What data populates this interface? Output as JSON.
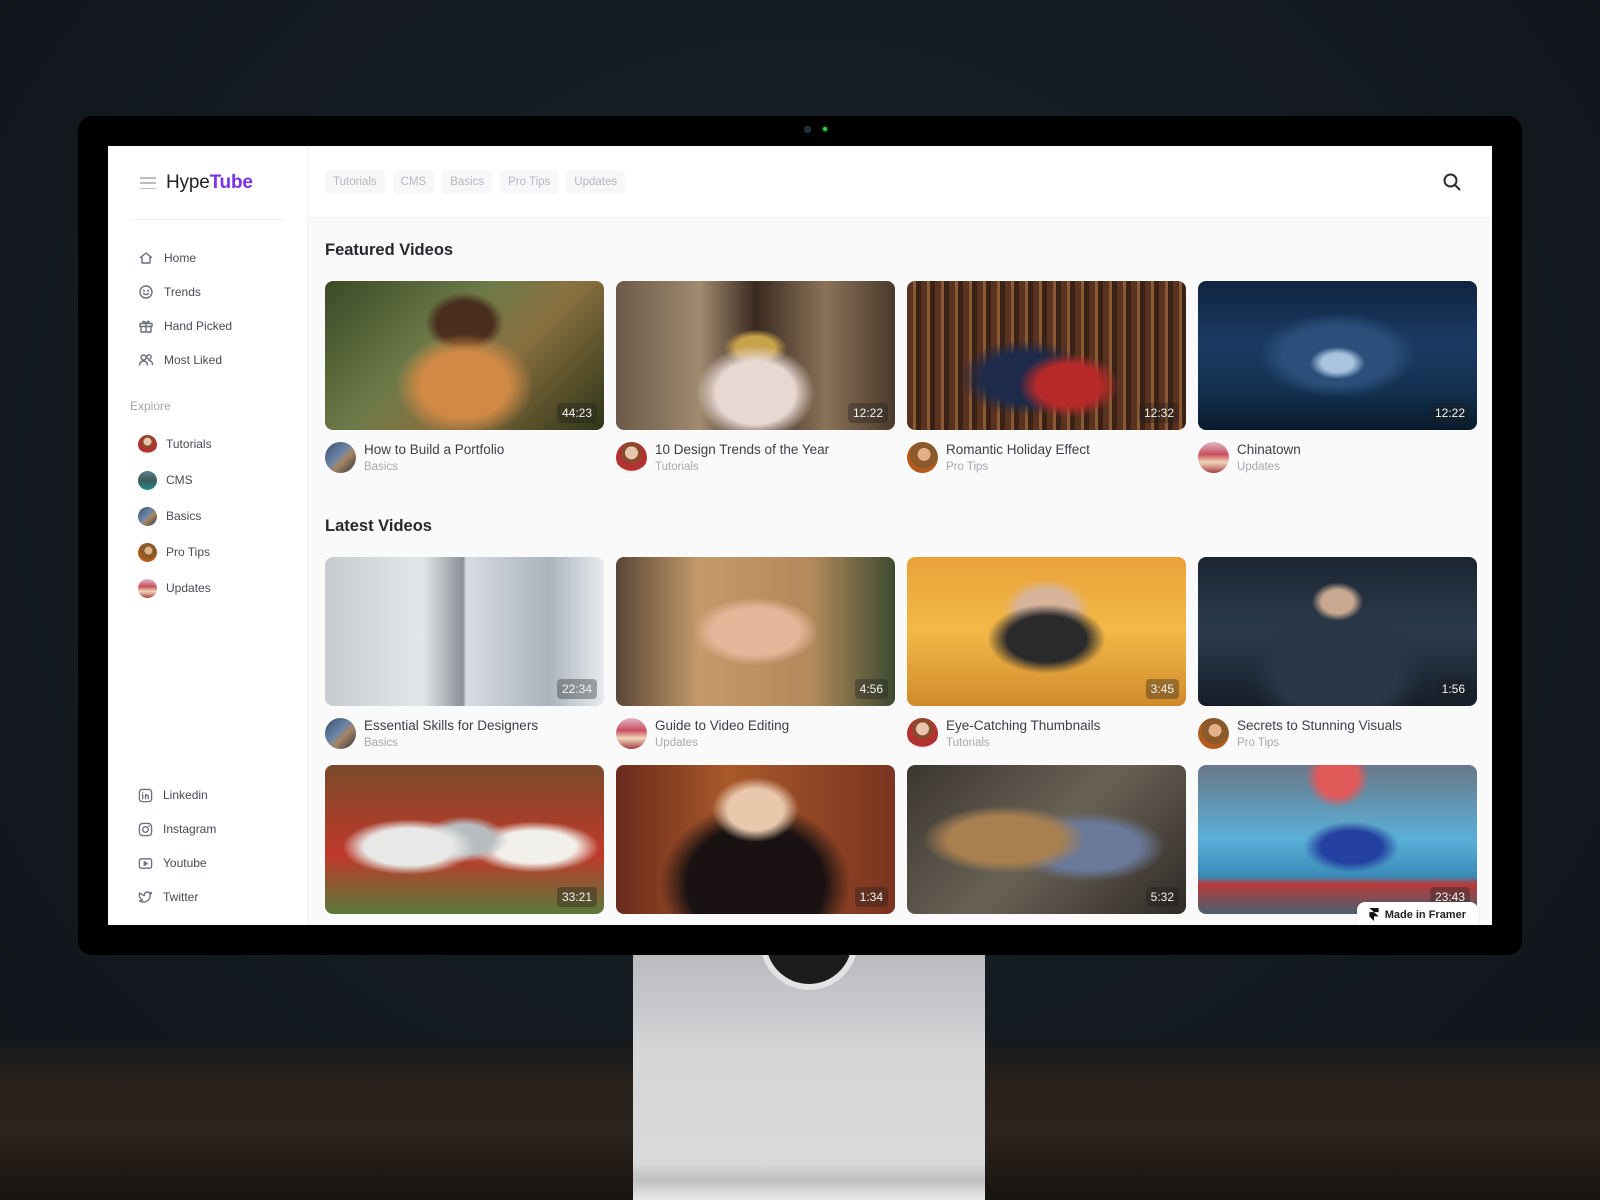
{
  "brand": {
    "prefix": "Hype",
    "accent": "Tube",
    "accent_color": "#7a32e6"
  },
  "topbar": {
    "chips": [
      "Tutorials",
      "CMS",
      "Basics",
      "Pro Tips",
      "Updates"
    ],
    "search_icon": "search-icon"
  },
  "sidebar": {
    "nav": [
      {
        "label": "Home",
        "icon": "home-icon"
      },
      {
        "label": "Trends",
        "icon": "smiley-icon"
      },
      {
        "label": "Hand Picked",
        "icon": "gift-icon"
      },
      {
        "label": "Most Liked",
        "icon": "users-icon"
      }
    ],
    "explore_label": "Explore",
    "explore": [
      {
        "label": "Tutorials"
      },
      {
        "label": "CMS"
      },
      {
        "label": "Basics"
      },
      {
        "label": "Pro Tips"
      },
      {
        "label": "Updates"
      }
    ],
    "socials": [
      {
        "label": "Linkedin",
        "icon": "linkedin-icon"
      },
      {
        "label": "Instagram",
        "icon": "instagram-icon"
      },
      {
        "label": "Youtube",
        "icon": "youtube-icon"
      },
      {
        "label": "Twitter",
        "icon": "twitter-icon"
      }
    ]
  },
  "featured": {
    "title": "Featured Videos",
    "videos": [
      {
        "title": "How to Build a Portfolio",
        "category": "Basics",
        "duration": "44:23"
      },
      {
        "title": "10 Design Trends of the Year",
        "category": "Tutorials",
        "duration": "12:22"
      },
      {
        "title": "Romantic Holiday Effect",
        "category": "Pro Tips",
        "duration": "12:32"
      },
      {
        "title": "Chinatown",
        "category": "Updates",
        "duration": "12:22"
      }
    ]
  },
  "latest": {
    "title": "Latest Videos",
    "videos": [
      {
        "title": "Essential Skills for Designers",
        "category": "Basics",
        "duration": "22:34"
      },
      {
        "title": "Guide to Video Editing",
        "category": "Updates",
        "duration": "4:56"
      },
      {
        "title": "Eye-Catching Thumbnails",
        "category": "Tutorials",
        "duration": "3:45"
      },
      {
        "title": "Secrets to Stunning Visuals",
        "category": "Pro Tips",
        "duration": "1:56"
      },
      {
        "duration": "33:21"
      },
      {
        "duration": "1:34"
      },
      {
        "duration": "5:32"
      },
      {
        "duration": "23:43"
      }
    ]
  },
  "framer_badge": "Made in Framer"
}
